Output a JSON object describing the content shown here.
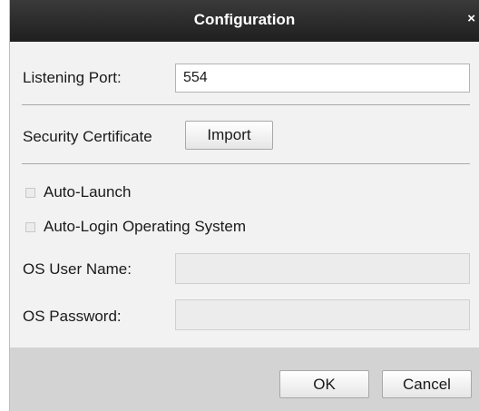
{
  "dialog": {
    "title": "Configuration",
    "close_glyph": "×"
  },
  "listening_port": {
    "label": "Listening Port:",
    "value": "554"
  },
  "security_certificate": {
    "label": "Security Certificate",
    "import_label": "Import"
  },
  "options": {
    "auto_launch": {
      "label": "Auto-Launch",
      "checked": false
    },
    "auto_login": {
      "label": "Auto-Login Operating System",
      "checked": false
    }
  },
  "os_user_name": {
    "label": "OS User Name:",
    "value": ""
  },
  "os_password": {
    "label": "OS Password:",
    "value": ""
  },
  "footer": {
    "ok_label": "OK",
    "cancel_label": "Cancel"
  },
  "colors": {
    "titlebar": "#2a2a2a",
    "dialog_bg": "#f2f2f2",
    "footer_bg": "#d3d3d3",
    "text": "#1a1a1a"
  }
}
